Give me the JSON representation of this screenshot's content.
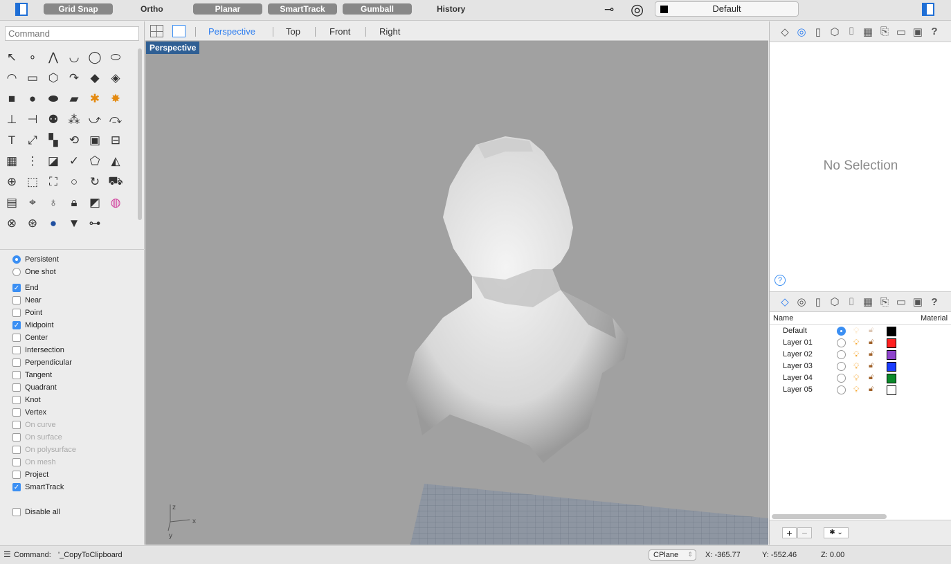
{
  "toolbar": {
    "grid_snap": "Grid Snap",
    "ortho": "Ortho",
    "planar": "Planar",
    "smarttrack": "SmartTrack",
    "gumball": "Gumball",
    "history": "History",
    "current_layer": "Default",
    "layer_color": "#000000"
  },
  "command": {
    "placeholder": "Command"
  },
  "tools": [
    "pointer-icon",
    "point-icon",
    "polyline-icon",
    "curve-icon",
    "circle-icon",
    "ellipse-icon",
    "arc-icon",
    "rectangle-icon",
    "polygon-icon",
    "fillet-icon",
    "surface-icon",
    "loft-icon",
    "box-icon",
    "sphere-icon",
    "cylinder-icon",
    "plane-icon",
    "gear-icon",
    "explode-icon",
    "trim-icon",
    "split-icon",
    "boolean-icon",
    "points-icon",
    "curve-edit-icon",
    "offset-icon",
    "text-icon",
    "move-icon",
    "array-icon",
    "rotate-icon",
    "solid-icon",
    "dimension-icon",
    "grid-icon",
    "align-icon",
    "layer-icon",
    "check-icon",
    "mesh-icon",
    "paint-icon",
    "zoom-in-icon",
    "zoom-window-icon",
    "zoom-extents-icon",
    "zoom-icon",
    "rotate-view-icon",
    "car-icon",
    "cplane-icon",
    "snap-icon",
    "light-icon",
    "lock-icon",
    "material-icon",
    "color-wheel-icon",
    "sphere-wire-icon",
    "globe-icon",
    "render-icon",
    "cone-icon",
    "tree-icon"
  ],
  "snaps": {
    "modes": [
      {
        "label": "Persistent",
        "on": true
      },
      {
        "label": "One shot",
        "on": false
      }
    ],
    "items": [
      {
        "label": "End",
        "on": true
      },
      {
        "label": "Near",
        "on": false
      },
      {
        "label": "Point",
        "on": false
      },
      {
        "label": "Midpoint",
        "on": true
      },
      {
        "label": "Center",
        "on": false
      },
      {
        "label": "Intersection",
        "on": false
      },
      {
        "label": "Perpendicular",
        "on": false
      },
      {
        "label": "Tangent",
        "on": false
      },
      {
        "label": "Quadrant",
        "on": false
      },
      {
        "label": "Knot",
        "on": false
      },
      {
        "label": "Vertex",
        "on": false
      },
      {
        "label": "On curve",
        "on": false,
        "disabled": true
      },
      {
        "label": "On surface",
        "on": false,
        "disabled": true
      },
      {
        "label": "On polysurface",
        "on": false,
        "disabled": true
      },
      {
        "label": "On mesh",
        "on": false,
        "disabled": true
      },
      {
        "label": "Project",
        "on": false
      },
      {
        "label": "SmartTrack",
        "on": true
      }
    ],
    "disable_all": "Disable all"
  },
  "viewtabs": {
    "items": [
      "Perspective",
      "Top",
      "Front",
      "Right"
    ],
    "active": "Perspective",
    "viewport_label": "Perspective"
  },
  "axes": {
    "x": "x",
    "y": "y",
    "z": "z"
  },
  "properties": {
    "empty": "No Selection",
    "help": "?"
  },
  "layers": {
    "columns": {
      "name": "Name",
      "material": "Material"
    },
    "rows": [
      {
        "name": "Default",
        "current": true,
        "color": "#000000"
      },
      {
        "name": "Layer 01",
        "current": false,
        "color": "#ff2020"
      },
      {
        "name": "Layer 02",
        "current": false,
        "color": "#8e44cc"
      },
      {
        "name": "Layer 03",
        "current": false,
        "color": "#1a3cff"
      },
      {
        "name": "Layer 04",
        "current": false,
        "color": "#0b8a2a"
      },
      {
        "name": "Layer 05",
        "current": false,
        "color": "#ffffff"
      }
    ],
    "add": "+",
    "remove": "−",
    "gear": "✱ ⌄"
  },
  "status": {
    "command_label": "Command:",
    "command_value": "'_CopyToClipboard",
    "cplane": "CPlane",
    "x": "X: -365.77",
    "y": "Y: -552.46",
    "z": "Z: 0.00"
  }
}
